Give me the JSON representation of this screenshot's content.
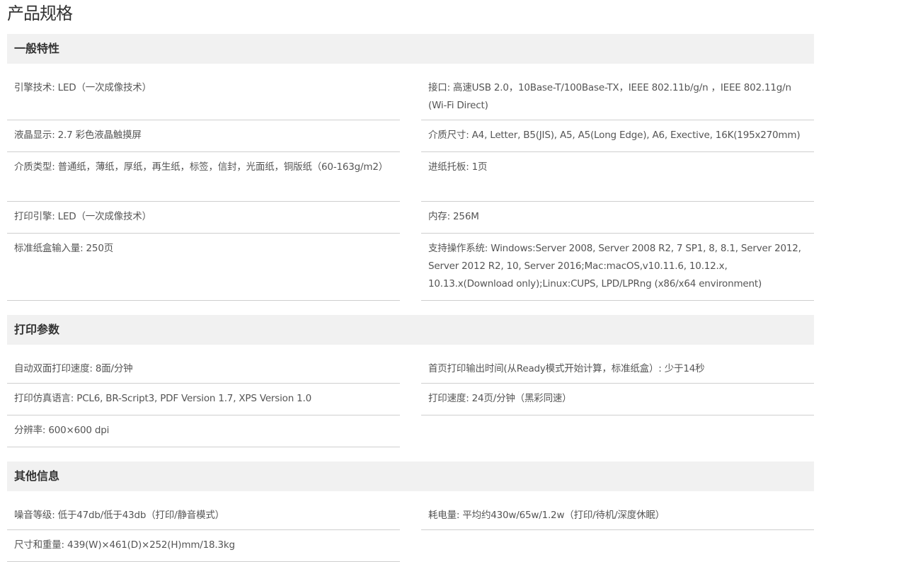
{
  "page_title": "产品规格",
  "sections": [
    {
      "title": "一般特性",
      "items": [
        {
          "label": "引擎技术: ",
          "value": "LED（一次成像技术）"
        },
        {
          "label": "接口: ",
          "value": "高速USB 2.0，10Base-T/100Base-TX，IEEE 802.11b/g/n ，IEEE 802.11g/n (Wi-Fi Direct)"
        },
        {
          "label": "液晶显示: ",
          "value": "2.7 彩色液晶触摸屏"
        },
        {
          "label": "介质尺寸: ",
          "value": "A4, Letter, B5(JIS), A5, A5(Long Edge), A6, Exective, 16K(195x270mm)"
        },
        {
          "label": "介质类型: ",
          "value": "普通纸，薄纸，厚纸，再生纸，标签，信封，光面纸，铜版纸（60-163g/m2）"
        },
        {
          "label": "进纸托板: ",
          "value": "1页"
        },
        {
          "label": "打印引擎: ",
          "value": "LED（一次成像技术）"
        },
        {
          "label": "内存: ",
          "value": "256M"
        },
        {
          "label": "标准纸盒输入量: ",
          "value": "250页"
        },
        {
          "label": "支持操作系统: ",
          "value": "Windows:Server 2008, Server 2008 R2, 7 SP1, 8, 8.1, Server 2012, Server 2012 R2, 10, Server 2016;Mac:macOS,v10.11.6, 10.12.x, 10.13.x(Download only);Linux:CUPS, LPD/LPRng (x86/x64 environment)"
        }
      ]
    },
    {
      "title": "打印参数",
      "items": [
        {
          "label": "自动双面打印速度: ",
          "value": "8面/分钟"
        },
        {
          "label": "首页打印输出时间(从Ready模式开始计算，标准纸盒）: ",
          "value": "少于14秒"
        },
        {
          "label": "打印仿真语言: ",
          "value": "PCL6, BR-Script3, PDF Version 1.7, XPS Version 1.0"
        },
        {
          "label": "打印速度: ",
          "value": "24页/分钟（黑彩同速）"
        },
        {
          "label": "分辨率: ",
          "value": "600×600 dpi"
        }
      ]
    },
    {
      "title": "其他信息",
      "items": [
        {
          "label": "噪音等级: ",
          "value": "低于47db/低于43db（打印/静音模式）"
        },
        {
          "label": "耗电量: ",
          "value": "平均约430w/65w/1.2w（打印/待机/深度休眠）"
        },
        {
          "label": "尺寸和重量: ",
          "value": "439(W)×461(D)×252(H)mm/18.3kg"
        }
      ]
    }
  ]
}
